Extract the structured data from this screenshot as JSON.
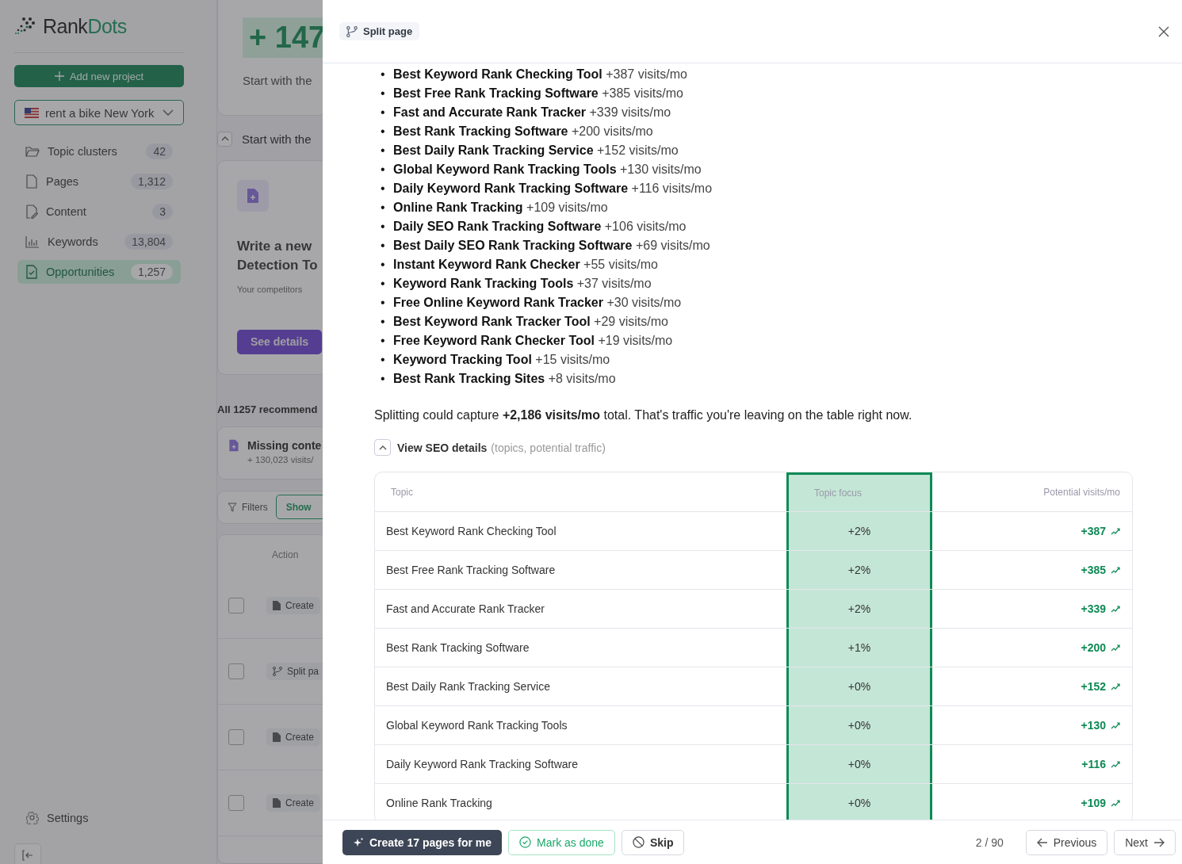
{
  "sidebar": {
    "logo": {
      "first": "Rank",
      "second": "Dots"
    },
    "add_button": "Add new project",
    "project": "rent a bike New York",
    "nav": [
      {
        "kind": "folder",
        "label": "Topic clusters",
        "count": "42",
        "selected": false
      },
      {
        "kind": "page",
        "label": "Pages",
        "count": "1,312",
        "selected": false
      },
      {
        "kind": "edit",
        "label": "Content",
        "count": "3",
        "selected": false
      },
      {
        "kind": "chart",
        "label": "Keywords",
        "count": "13,804",
        "selected": false
      },
      {
        "kind": "check",
        "label": "Opportunities",
        "count": "1,257",
        "selected": true
      }
    ],
    "settings": "Settings"
  },
  "background": {
    "stat": "+ 147",
    "stat_caption": "Start with the",
    "section_title": "Start with the",
    "section_expanded": true,
    "card": {
      "title_line_1": "Write a new",
      "title_line_2": "Detection To",
      "text": "Your competitors",
      "button": "See details"
    },
    "recommendations_title": "All 1257 recommend",
    "summary": {
      "title": "Missing conte",
      "visits": "+ 130,023 visits/"
    },
    "filters": {
      "label": "Filters",
      "show_button": "Show"
    },
    "table": {
      "column": "Action",
      "rows": [
        {
          "kind": "create",
          "label": "Create",
          "checked": false
        },
        {
          "kind": "split",
          "label": "Split pa",
          "checked": false
        },
        {
          "kind": "create",
          "label": "Create",
          "checked": false
        },
        {
          "kind": "create",
          "label": "Create",
          "checked": false
        }
      ]
    }
  },
  "drawer": {
    "tag": "Split page",
    "keywords": [
      {
        "bullet": "•",
        "keyword": "Best Keyword Rank Checking Tool",
        "visits": "+387 visits/mo"
      },
      {
        "bullet": "•",
        "keyword": "Best Free Rank Tracking Software",
        "visits": "+385 visits/mo"
      },
      {
        "bullet": "•",
        "keyword": "Fast and Accurate Rank Tracker",
        "visits": "+339 visits/mo"
      },
      {
        "bullet": "•",
        "keyword": "Best Rank Tracking Software",
        "visits": "+200 visits/mo"
      },
      {
        "bullet": "•",
        "keyword": "Best Daily Rank Tracking Service",
        "visits": "+152 visits/mo"
      },
      {
        "bullet": "•",
        "keyword": "Global Keyword Rank Tracking Tools",
        "visits": "+130 visits/mo"
      },
      {
        "bullet": "•",
        "keyword": "Daily Keyword Rank Tracking Software",
        "visits": "+116 visits/mo"
      },
      {
        "bullet": "•",
        "keyword": "Online Rank Tracking",
        "visits": "+109 visits/mo"
      },
      {
        "bullet": "•",
        "keyword": "Daily SEO Rank Tracking Software",
        "visits": "+106 visits/mo"
      },
      {
        "bullet": "•",
        "keyword": "Best Daily SEO Rank Tracking Software",
        "visits": "+69 visits/mo"
      },
      {
        "bullet": "•",
        "keyword": "Instant Keyword Rank Checker",
        "visits": "+55 visits/mo"
      },
      {
        "bullet": "•",
        "keyword": "Keyword Rank Tracking Tools",
        "visits": "+37 visits/mo"
      },
      {
        "bullet": "•",
        "keyword": "Free Online Keyword Rank Tracker",
        "visits": "+30 visits/mo"
      },
      {
        "bullet": "•",
        "keyword": "Best Keyword Rank Tracker Tool",
        "visits": "+29 visits/mo"
      },
      {
        "bullet": "•",
        "keyword": "Free Keyword Rank Checker Tool",
        "visits": "+19 visits/mo"
      },
      {
        "bullet": "•",
        "keyword": "Keyword Tracking Tool",
        "visits": "+15 visits/mo"
      },
      {
        "bullet": "•",
        "keyword": "Best Rank Tracking Sites",
        "visits": "+8 visits/mo"
      }
    ],
    "summary": "Splitting could capture **+2,186 visits/mo** total. That's traffic you're leaving on the table right now.",
    "details_toggle": {
      "label": "View SEO details",
      "hint": "(topics, potential traffic)",
      "expanded": true
    },
    "table": {
      "columns": [
        {
          "label": "Topic",
          "highlighted": false
        },
        {
          "label": "Topic focus",
          "highlighted": true
        },
        {
          "label": "Potential visits/mo",
          "highlighted": false
        }
      ],
      "rows": [
        {
          "topic": "Best Keyword Rank Checking Tool",
          "focus": "+2%",
          "visits": "+387"
        },
        {
          "topic": "Best Free Rank Tracking Software",
          "focus": "+2%",
          "visits": "+385"
        },
        {
          "topic": "Fast and Accurate Rank Tracker",
          "focus": "+2%",
          "visits": "+339"
        },
        {
          "topic": "Best Rank Tracking Software",
          "focus": "+1%",
          "visits": "+200"
        },
        {
          "topic": "Best Daily Rank Tracking Service",
          "focus": "+0%",
          "visits": "+152"
        },
        {
          "topic": "Global Keyword Rank Tracking Tools",
          "focus": "+0%",
          "visits": "+130"
        },
        {
          "topic": "Daily Keyword Rank Tracking Software",
          "focus": "+0%",
          "visits": "+116"
        },
        {
          "topic": "Online Rank Tracking",
          "focus": "+0%",
          "visits": "+109"
        }
      ]
    },
    "footer": {
      "create_button": "Create 17 pages for me",
      "done_button": "Mark as done",
      "skip_button": "Skip",
      "pager": "2 / 90",
      "previous": "Previous",
      "next": "Next"
    }
  }
}
